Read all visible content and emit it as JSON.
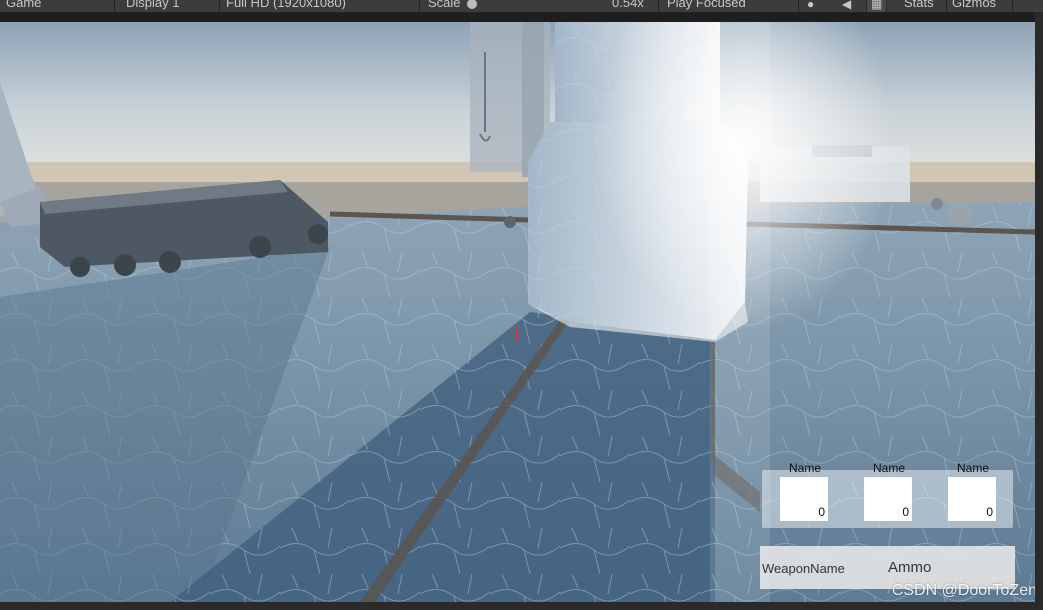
{
  "toolbar": {
    "view_label": "Game",
    "display_label": "Display 1",
    "resolution_label": "Full HD (1920x1080)",
    "scale_label": "Scale",
    "scale_value": "0.54x",
    "play_mode_label": "Play Focused",
    "stats_label": "Stats",
    "gizmos_label": "Gizmos",
    "icons": [
      "bug-icon",
      "speaker-icon",
      "grid-icon"
    ]
  },
  "game_ui": {
    "crosshair_color": "#d9323a",
    "slots": [
      {
        "name": "Name",
        "count": "0"
      },
      {
        "name": "Name",
        "count": "0"
      },
      {
        "name": "Name",
        "count": "0"
      }
    ],
    "weapon": {
      "name": "WeaponName",
      "ammo": "Ammo"
    }
  },
  "watermark": "CSDN @DoorToZen"
}
